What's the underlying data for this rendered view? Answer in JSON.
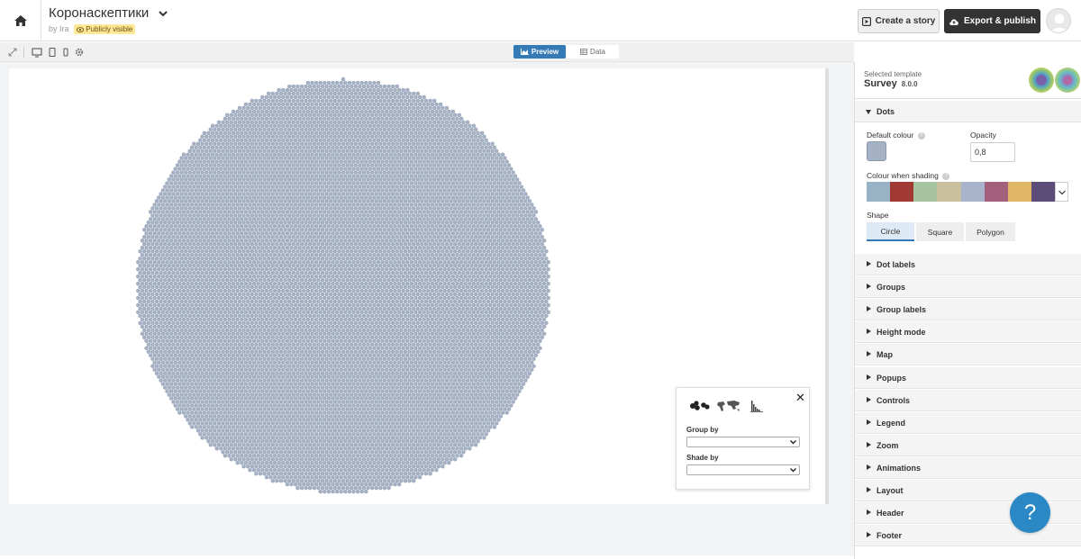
{
  "header": {
    "title": "Коронаскептики",
    "by_prefix": "by",
    "author": "Ira",
    "visibility_badge": "Publicly visible",
    "create_story_label": "Create a story",
    "export_label": "Export & publish"
  },
  "toolbar": {
    "preview_label": "Preview",
    "data_label": "Data",
    "active_tab": "Preview"
  },
  "controls_popup": {
    "group_by_label": "Group by",
    "shade_by_label": "Shade by",
    "group_by_value": "",
    "shade_by_value": "",
    "icons": [
      "clusters-icon",
      "world-map-icon",
      "histogram-icon"
    ]
  },
  "panel": {
    "selected_template_label": "Selected template",
    "template_name": "Survey",
    "template_version": "8.0.0",
    "dots_section": {
      "title": "Dots",
      "default_colour_label": "Default colour",
      "default_colour": "#a5b1c4",
      "opacity_label": "Opacity",
      "opacity_value": "0,8",
      "colour_shading_label": "Colour when shading",
      "palette": [
        "#98b2c6",
        "#a13a32",
        "#a5c49f",
        "#c8c09e",
        "#a9b3cc",
        "#a3607c",
        "#e0b565",
        "#5b4d77"
      ],
      "shape_label": "Shape",
      "shape_options": [
        "Circle",
        "Square",
        "Polygon"
      ],
      "shape_selected": "Circle"
    },
    "sections": [
      "Dot labels",
      "Groups",
      "Group labels",
      "Height mode",
      "Map",
      "Popups",
      "Controls",
      "Legend",
      "Zoom",
      "Animations",
      "Layout",
      "Header",
      "Footer"
    ]
  },
  "help_button": "?",
  "theme": {
    "accent": "#337ab7",
    "dark_button": "#333333",
    "fab": "#2a88c5",
    "dot_fill": "#a5b1c4"
  }
}
